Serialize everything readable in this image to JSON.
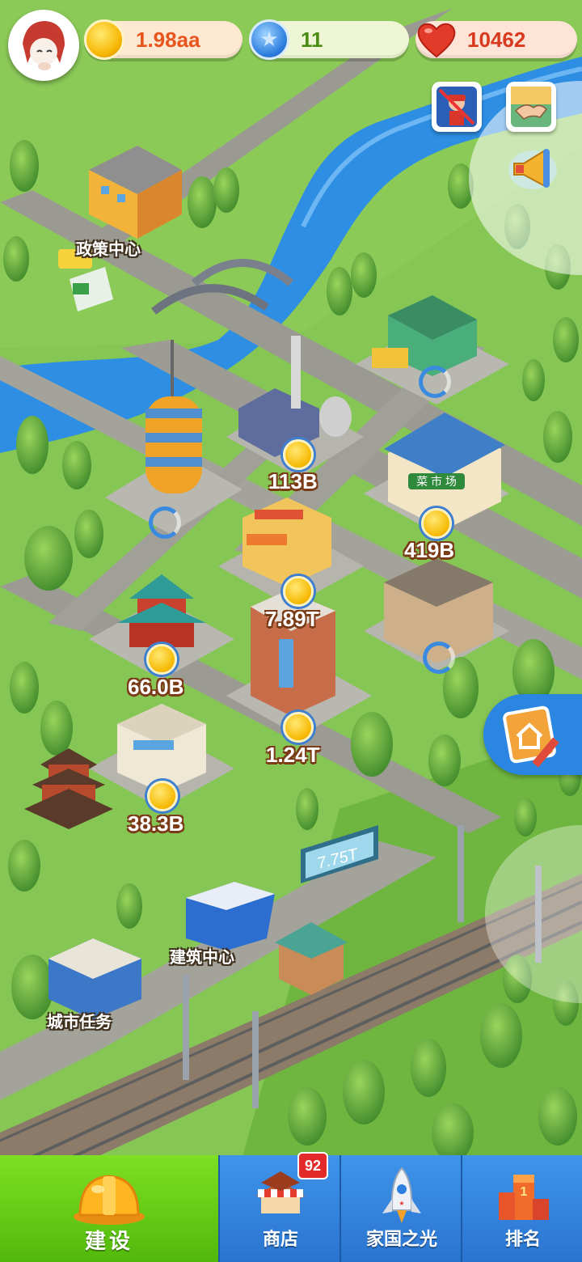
{
  "hud": {
    "coins": "1.98aa",
    "stars": "11",
    "hearts": "10462"
  },
  "map_labels": {
    "policy_center": "政策中心",
    "building_center": "建筑中心",
    "city_tasks": "城市任务"
  },
  "incomes": {
    "factory": "113B",
    "market": "419B",
    "shop": "7.89T",
    "temple": "66.0B",
    "apartment": "1.24T",
    "office": "38.3B",
    "billboard": "7.75T"
  },
  "building_signs": {
    "market_sign": "菜 市 场"
  },
  "nav": {
    "build": "建设",
    "shop": "商店",
    "shop_badge": "92",
    "glory": "家国之光",
    "rank": "排名"
  },
  "colors": {
    "grass": "#7cc04a",
    "river": "#2d8ee3",
    "road": "#9a9a92",
    "nav_green": "#6bd21a",
    "nav_blue": "#3a88de"
  }
}
